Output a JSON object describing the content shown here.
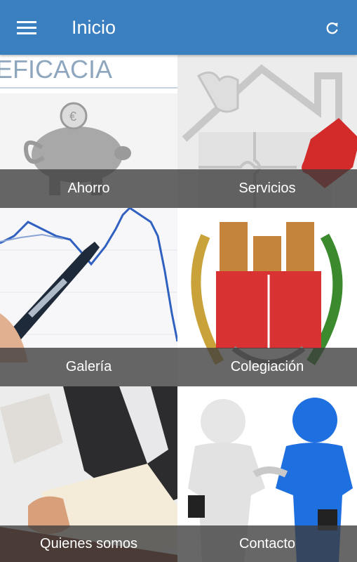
{
  "app_bar": {
    "title": "Inicio",
    "background_color": "#3a7fc0",
    "menu_icon": "hamburger-menu-icon",
    "refresh_icon": "refresh-icon"
  },
  "tiles": [
    {
      "label": "Ahorro",
      "image": "piggy-bank-eficacia-photo",
      "image_text": "EFICACIA"
    },
    {
      "label": "Servicios",
      "image": "puzzle-house-photo"
    },
    {
      "label": "Galería",
      "image": "pen-on-stock-chart-photo"
    },
    {
      "label": "Colegiación",
      "image": "college-coat-of-arms"
    },
    {
      "label": "Quienes somos",
      "image": "person-signing-document-photo"
    },
    {
      "label": "Contacto",
      "image": "handshake-figures-photo"
    }
  ]
}
